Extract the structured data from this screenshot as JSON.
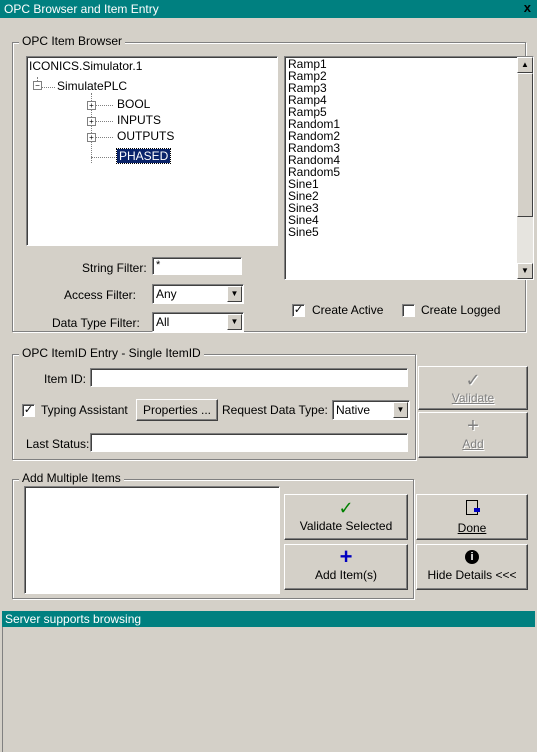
{
  "window": {
    "title": "OPC Browser and Item Entry",
    "close": "x"
  },
  "browser": {
    "legend": "OPC Item Browser",
    "tree": {
      "root": "ICONICS.Simulator.1",
      "child": "SimulatePLC",
      "nodes": [
        "BOOL",
        "INPUTS",
        "OUTPUTS",
        "PHASED"
      ],
      "selected": "PHASED"
    },
    "items": [
      "Ramp1",
      "Ramp2",
      "Ramp3",
      "Ramp4",
      "Ramp5",
      "Random1",
      "Random2",
      "Random3",
      "Random4",
      "Random5",
      "Sine1",
      "Sine2",
      "Sine3",
      "Sine4",
      "Sine5"
    ],
    "string_filter_label": "String Filter:",
    "string_filter_value": "*",
    "access_filter_label": "Access Filter:",
    "access_filter_value": "Any",
    "datatype_filter_label": "Data Type Filter:",
    "datatype_filter_value": "All",
    "create_active_label": "Create Active",
    "create_active_checked": true,
    "create_logged_label": "Create Logged",
    "create_logged_checked": false
  },
  "entry": {
    "legend": "OPC ItemID Entry - Single ItemID",
    "item_id_label": "Item ID:",
    "item_id_value": "",
    "typing_assistant_label": "Typing Assistant",
    "typing_assistant_checked": true,
    "properties_button": "Properties ...",
    "request_type_label": "Request Data Type:",
    "request_type_value": "Native",
    "last_status_label": "Last Status:",
    "last_status_value": "",
    "validate_button": "Validate",
    "add_button": "Add"
  },
  "multiple": {
    "legend": "Add Multiple Items",
    "validate_selected_button": "Validate Selected",
    "add_items_button": "Add Item(s)"
  },
  "actions": {
    "done_button": "Done",
    "hide_details_button": "Hide Details <<<"
  },
  "status": {
    "text": "Server supports browsing"
  },
  "icons": {
    "check_icon": "✓",
    "plus_icon": "+",
    "door_icon": "door-exit-icon",
    "info_icon": "i"
  },
  "colors": {
    "title_bg": "#008080",
    "check_green": "#008000",
    "plus_blue": "#0000c0"
  }
}
